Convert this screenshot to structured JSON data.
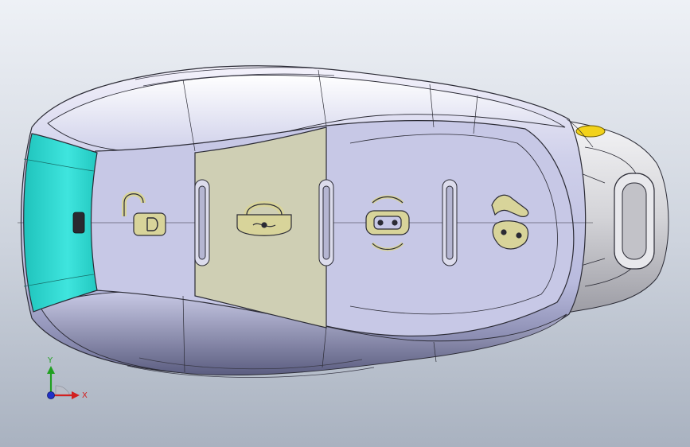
{
  "viewport": {
    "background_top": "#eef1f6",
    "background_bottom": "#a9b2c0"
  },
  "model": {
    "colors": {
      "shell": "#c4c6e4",
      "shell_light": "#eceaf8",
      "shell_dark": "#7d7fa6",
      "edge_lines": "#2b2b35",
      "tip_face": "#2fd8d0",
      "selected_button_face": "#cfcfb4",
      "loop_metal": "#d8d8dc",
      "indicator": "#f2d21a",
      "icon_fill": "#d8d49a"
    },
    "buttons": [
      {
        "name": "unlock",
        "icon": "unlock-padlock-icon"
      },
      {
        "name": "lock",
        "icon": "locked-padlock-icon",
        "selected": true
      },
      {
        "name": "panic",
        "icon": "car-alarm-icon"
      },
      {
        "name": "trunk",
        "icon": "trunk-open-icon"
      }
    ]
  },
  "triad": {
    "y_label": "Y",
    "x_label": "X",
    "colors": {
      "x": "#d22020",
      "y": "#20a020",
      "z": "#2030c8"
    }
  }
}
